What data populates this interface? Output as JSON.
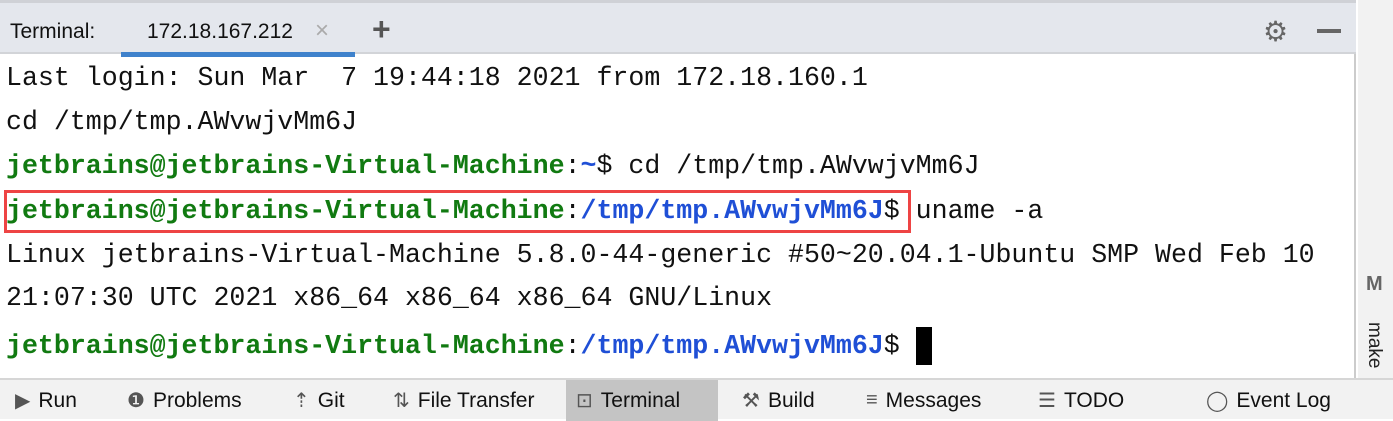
{
  "header": {
    "label": "Terminal:",
    "tab": "172.18.167.212",
    "close": "×",
    "add": "+",
    "settings_icon": "gear-icon",
    "minimize_icon": "minimize-icon"
  },
  "terminal": {
    "lines": [
      "Last login: Sun Mar  7 19:44:18 2021 from 172.18.160.1",
      "cd /tmp/tmp.AWvwjvMm6J",
      "Linux jetbrains-Virtual-Machine 5.8.0-44-generic #50~20.04.1-Ubuntu SMP Wed Feb 10",
      "21:07:30 UTC 2021 x86_64 x86_64 x86_64 GNU/Linux"
    ],
    "user": "jetbrains@jetbrains-Virtual-Machine",
    "colon": ":",
    "dollar": "$",
    "prompt1_path": "~",
    "prompt1_cmd": " cd /tmp/tmp.AWvwjvMm6J",
    "prompt2_path": "/tmp/tmp.AWvwjvMm6J",
    "prompt2_cmd": " uname -a",
    "prompt3_path": "/tmp/tmp.AWvwjvMm6J",
    "colors": {
      "user": "#117a11",
      "path": "#1f4fd6",
      "highlight": "#ee4444"
    }
  },
  "right_strip": {
    "icon": "M",
    "label": "make"
  },
  "bottom": {
    "items": [
      {
        "label": "Run",
        "icon": "▶"
      },
      {
        "label": "Problems",
        "icon": "❶"
      },
      {
        "label": "Git",
        "icon": "⇡"
      },
      {
        "label": "File Transfer",
        "icon": "⇅"
      },
      {
        "label": "Terminal",
        "icon": "⊡"
      },
      {
        "label": "Build",
        "icon": "⚒"
      },
      {
        "label": "Messages",
        "icon": "≡"
      },
      {
        "label": "TODO",
        "icon": "☰"
      },
      {
        "label": "Event Log",
        "icon": "◯"
      }
    ]
  }
}
